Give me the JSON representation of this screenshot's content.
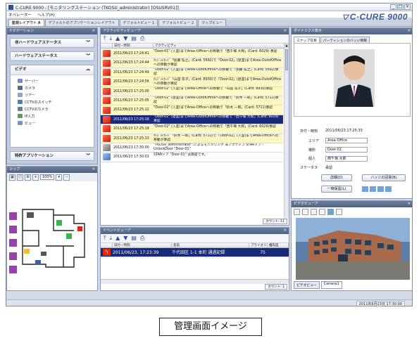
{
  "window": {
    "title": "C-CURE 9000 - [モニタリングステーション (TKOSU_administrator) [OSUSRV01]]",
    "menu": [
      "オペレーター",
      "ヘルプ(H)"
    ],
    "logo": "C·CURE 9000",
    "tabs": [
      "監視レイアウト A",
      "デフォルトのアプリケーションレイアウト",
      "デフォルトビュー 1",
      "デフォルトビュー 2",
      "マップビュー"
    ]
  },
  "nav_panel": {
    "title": "ナビゲーション",
    "sections": [
      "非ハードウェアステータス",
      "ハードウェアステータス"
    ],
    "video": {
      "label": "ビデオ",
      "items": [
        "サーバー",
        "カメラ",
        "ツアー",
        "CCTVのスイッチ",
        "CCTVのカメラ",
        "IP入力",
        "ビュー"
      ]
    },
    "bottom_section": "特許アプリケーション"
  },
  "map_panel": {
    "title": "マップ",
    "zoom": "100%"
  },
  "activity_panel": {
    "title": "アクティビティビューア",
    "columns": [
      "日付・時刻",
      "アクティビティ"
    ],
    "rows": [
      {
        "date": "2011/06/23 17:24:41",
        "text": "\"Door-01\" (入室)までArea-Officeへの移動で「西千場 大郎」(Card: 6029) 承認",
        "style": "yellow",
        "icon": "red"
      },
      {
        "date": "2011/06/23 17:24:44",
        "text": "ｸﾚｼﾞｯﾄｶｰﾄﾞ「加藤 弘之」(Card: 5692)で「Door-02」(退室)までArea-OutofOfficeへの移動が承認",
        "style": "yellow",
        "icon": "red"
      },
      {
        "date": "2011/06/23 17:24:49",
        "text": "\"Door-02\" (入室)までArea-OutofOfficeへの移動で「加藤 弘之」(Card: 5692)承認",
        "style": "yellow",
        "icon": "red"
      },
      {
        "date": "2011/06/23 17:24:56",
        "text": "ｸﾚｼﾞｯﾄｶｰﾄﾞ「山田 花子」(Card: 8930)で「Door-02」(退室)までArea-OutofOfficeへの移動が承認",
        "style": "yellow",
        "icon": "red"
      },
      {
        "date": "2011/06/23 17:25:00",
        "text": "\"Door-02\" (入室)までArea-Officeへの移動で「山田 花子」(Card: 8930)承認",
        "style": "yellow",
        "icon": "red"
      },
      {
        "date": "2011/06/23 17:25:05",
        "text": "\"Door-02\" (退室)までArea-OutofOfficeへの移動で「鈴木 一郎」(Card: 5711)承認",
        "style": "yellow",
        "icon": "red"
      },
      {
        "date": "2011/06/23 17:25:12",
        "text": "\"Door-02\" (入室)までArea-Officeへの移動で「鈴木 一郎」(Card: 5711)承認",
        "style": "yellow",
        "icon": "red"
      },
      {
        "date": "2011/06/23 17:25:16",
        "text": "\"Door-02\" (退室)までArea-OutofOfficeへの移動で「西千場 大郎」(Card: 6029)承認",
        "style": "sel",
        "icon": "red"
      },
      {
        "date": "2011/06/23 17:25:19",
        "text": "\"Door-02\" (入室)までArea-Officeへの移動で「西千場 大郎」(Card: 6029)承認",
        "style": "yellow",
        "icon": "red"
      },
      {
        "date": "2011/06/23 17:25:23",
        "text": "ｸﾚｼﾞｯﾄｶｰﾄﾞ「鈴木 一郎」(Card: 5711)で「Door-02」(入室)までArea-Officeへの移動が承認",
        "style": "yellow",
        "icon": "red"
      },
      {
        "date": "2011/06/23 17:30:00",
        "text": "\"TKOSU_administrator\" によるモニタリング 非アクティブ STARドア - UnlockDoor \"Door-01\"",
        "style": "white",
        "icon": "gray"
      },
      {
        "date": "2011/06/23 17:30:01",
        "text": "STARドア \"Door-01\" は施錠です。",
        "style": "white",
        "icon": "blue"
      }
    ],
    "count_label": "カウント: 11"
  },
  "event_panel": {
    "title": "イベントビューア",
    "columns": [
      "日付・時刻",
      "名前",
      "プライオリティ",
      "優先度"
    ],
    "rows": [
      {
        "date": "2011/06/23, 17:23:39",
        "name": "千代田区 1-1 本町 通過記録",
        "priority": "75"
      }
    ],
    "count_label": "カウント: 1"
  },
  "photo_panel": {
    "title": "ダイナミクス表示",
    "tabs": [
      "スナップ写真",
      "パーティションのバッジ情報"
    ],
    "fields": [
      {
        "label": "日付・時刻",
        "value": "2011/06/23 17:25:33"
      },
      {
        "label": "エリア",
        "value": "Area-Office"
      },
      {
        "label": "場所",
        "value": "Door-02"
      },
      {
        "label": "個人",
        "value": "西千場 大郎"
      },
      {
        "label": "ステータス",
        "value": "承認"
      }
    ],
    "buttons": [
      "詳細(D)",
      "バッジの回答(B)",
      "一時保留(L)"
    ]
  },
  "video_panel": {
    "title": "ビデオビューア",
    "tabs": [
      "ビデオビュー",
      "Camera1"
    ]
  },
  "status_bar": {
    "datetime": "2011年6月23日 17:30:00"
  },
  "caption": "管理画面イメージ",
  "colors": {
    "selected_row": "#1a2a7a",
    "highlight_row": "#fdf7c4",
    "panel_header": "#4e6283",
    "event_icon": "#d8281a"
  }
}
